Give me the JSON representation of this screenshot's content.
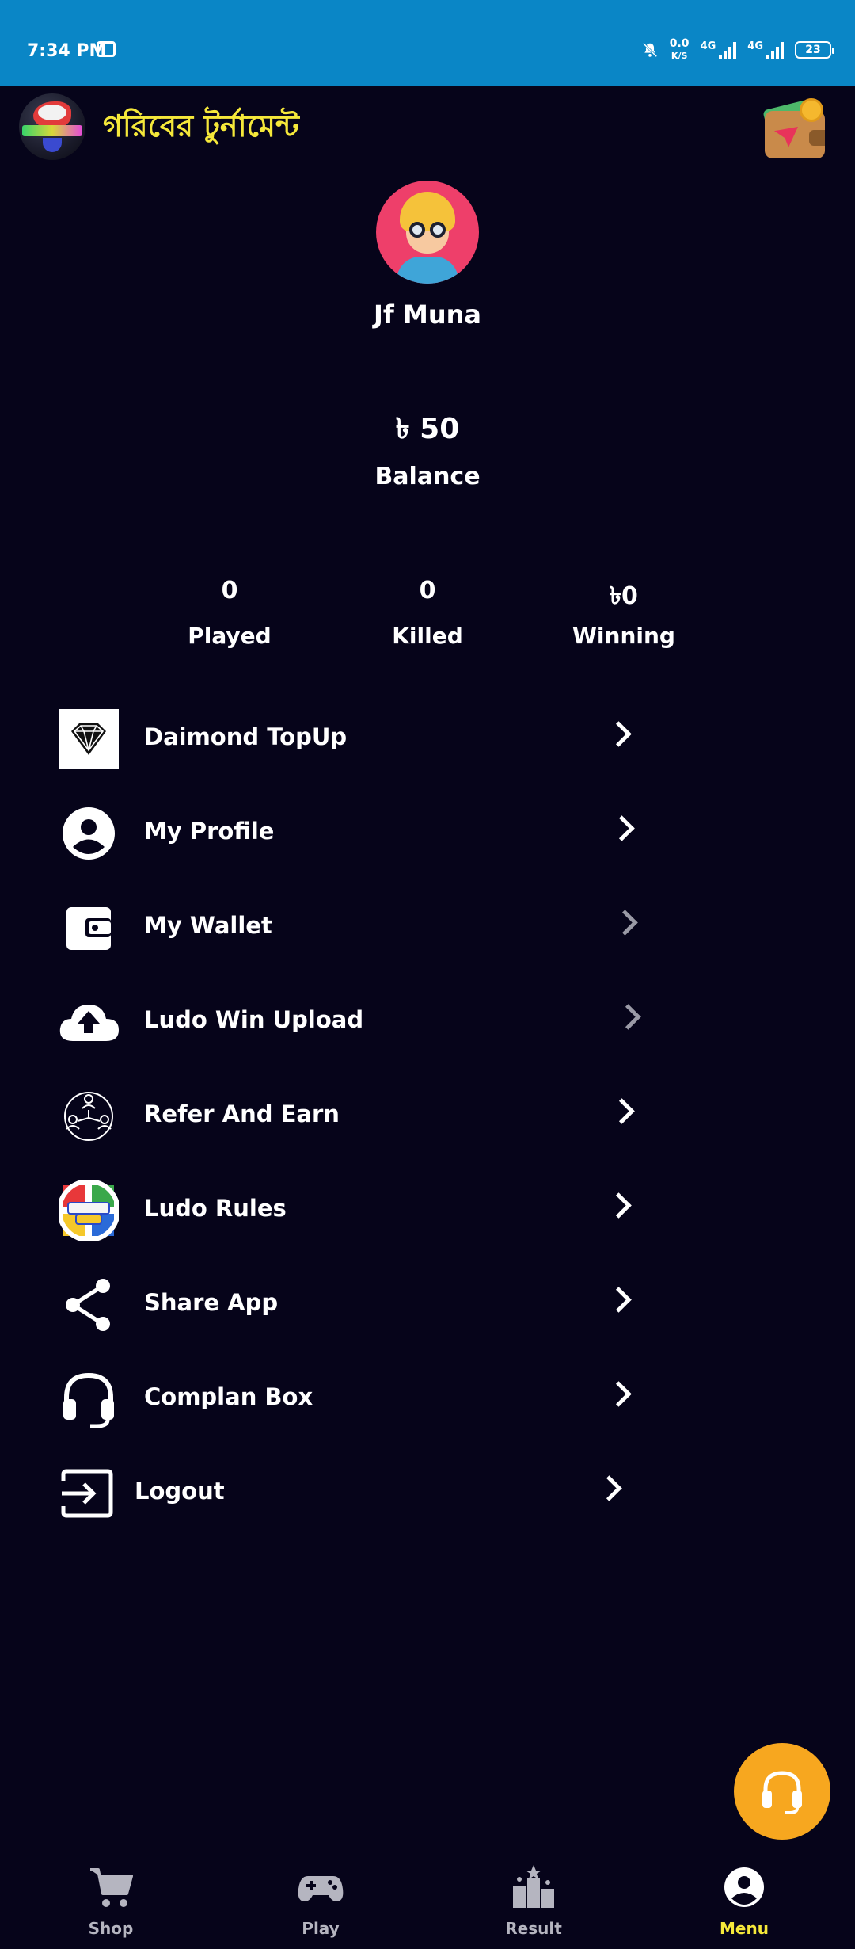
{
  "status_bar": {
    "time": "7:34 PM",
    "net_speed_value": "0.0",
    "net_speed_unit": "K/S",
    "net1": "4G",
    "net2": "4G",
    "battery": "23"
  },
  "header": {
    "title": "গরিবের টুর্নামেন্ট",
    "logo_icon": "tournament-logo-icon",
    "wallet_icon": "wallet-icon"
  },
  "profile": {
    "name": "Jf Muna",
    "avatar_icon": "avatar-icon"
  },
  "balance": {
    "amount": "৳ 50",
    "label": "Balance"
  },
  "stats": [
    {
      "value": "0",
      "label": "Played"
    },
    {
      "value": "0",
      "label": "Killed"
    },
    {
      "value": "৳0",
      "label": "Winning"
    }
  ],
  "menu": [
    {
      "label": "Daimond TopUp",
      "icon": "diamond-icon"
    },
    {
      "label": "My Profile",
      "icon": "user-circle-icon"
    },
    {
      "label": "My Wallet",
      "icon": "wallet-icon"
    },
    {
      "label": "Ludo Win Upload",
      "icon": "cloud-upload-icon"
    },
    {
      "label": "Refer And Earn",
      "icon": "referral-network-icon"
    },
    {
      "label": "Ludo Rules",
      "icon": "ludo-king-icon"
    },
    {
      "label": "Share App",
      "icon": "share-icon"
    },
    {
      "label": "Complan Box",
      "icon": "headset-icon"
    },
    {
      "label": "Logout",
      "icon": "logout-icon"
    }
  ],
  "support_fab_icon": "headset-icon",
  "bottom_nav": [
    {
      "label": "Shop",
      "icon": "cart-icon"
    },
    {
      "label": "Play",
      "icon": "gamepad-icon"
    },
    {
      "label": "Result",
      "icon": "podium-icon"
    },
    {
      "label": "Menu",
      "icon": "account-circle-icon",
      "active": true
    }
  ],
  "colors": {
    "background": "#06041a",
    "status_bar": "#0a86c6",
    "title": "#f5e83a",
    "fab": "#f7a71f",
    "nav_active": "#f5e83a",
    "nav_inactive": "#b5b5c0"
  }
}
